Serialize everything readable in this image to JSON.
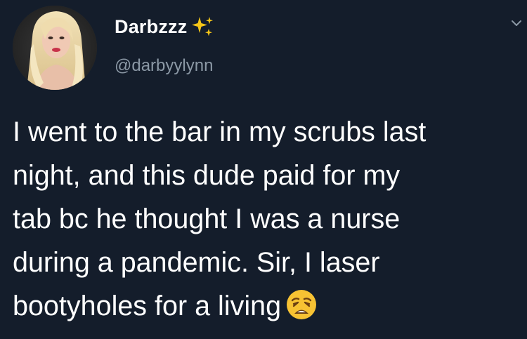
{
  "author": {
    "display_name": "Darbzzz",
    "handle": "@darbyylynn",
    "badge_icon": "sparkles-icon",
    "avatar_icon": "profile-photo"
  },
  "tweet": {
    "lines": [
      "I went to the bar in my scrubs last",
      "night, and this dude paid for my",
      "tab bc he thought I was a nurse",
      "during a pandemic. Sir, I laser",
      "bootyholes for a living"
    ],
    "trailing_emoji": "weary-face-icon"
  },
  "colors": {
    "background": "#141d2b",
    "text": "#ffffff",
    "handle": "#8b98a5",
    "sparkles": "#f5c518",
    "emoji": "#f7c233"
  }
}
